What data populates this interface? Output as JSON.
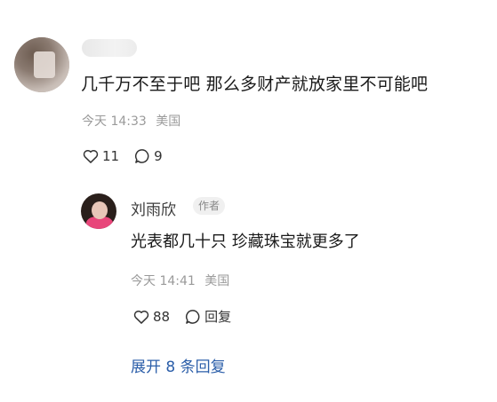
{
  "comment": {
    "text": "几千万不至于吧 那么多财产就放家里不可能吧",
    "time": "今天 14:33",
    "location": "美国",
    "like_count": "11",
    "reply_count": "9"
  },
  "reply": {
    "username": "刘雨欣",
    "badge": "作者",
    "text": "光表都几十只 珍藏珠宝就更多了",
    "time": "今天 14:41",
    "location": "美国",
    "like_count": "88",
    "reply_label": "回复"
  },
  "expand_replies_label": "展开 8 条回复",
  "icons": {
    "like": "heart-icon",
    "comment": "comment-bubble-icon"
  },
  "colors": {
    "link": "#2b5ea9",
    "meta": "#9a9a9a",
    "text": "#1a1a1a"
  }
}
